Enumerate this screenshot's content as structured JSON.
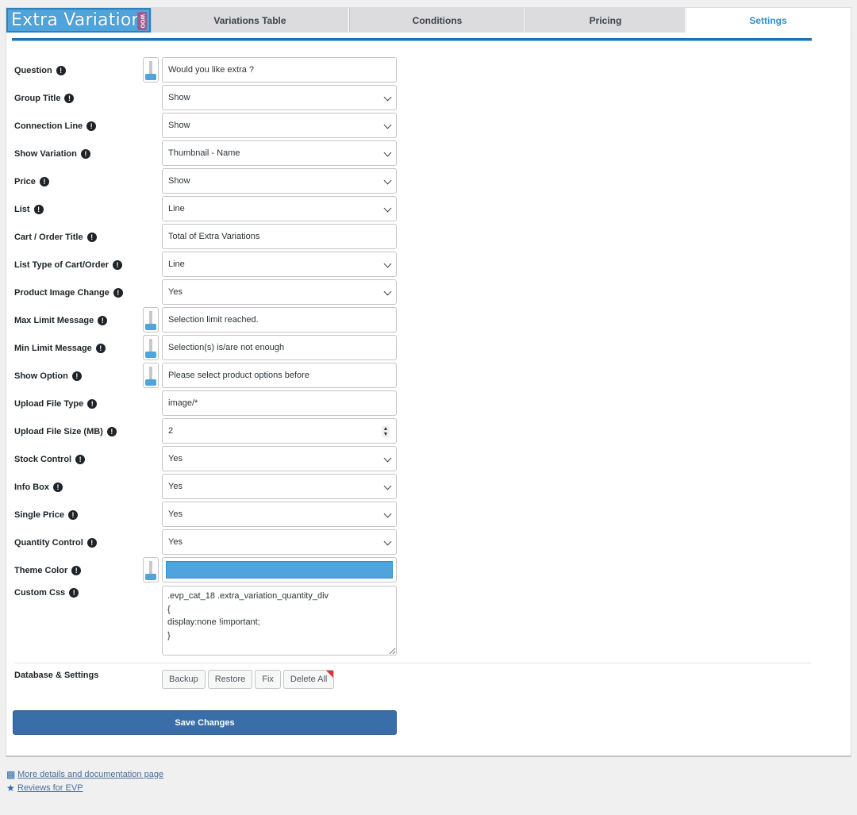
{
  "header": {
    "logo_text": "Extra Variation",
    "logo_badge": "WOO",
    "tabs": [
      {
        "label": "Variations Table",
        "active": false
      },
      {
        "label": "Conditions",
        "active": false
      },
      {
        "label": "Pricing",
        "active": false
      },
      {
        "label": "Settings",
        "active": true
      }
    ]
  },
  "settings": {
    "info_glyph": "!",
    "rows": [
      {
        "label": "Question",
        "type": "text",
        "value": "Would you like extra ?",
        "toggle": true
      },
      {
        "label": "Group Title",
        "type": "select",
        "value": "Show"
      },
      {
        "label": "Connection Line",
        "type": "select",
        "value": "Show"
      },
      {
        "label": "Show Variation",
        "type": "select",
        "value": "Thumbnail - Name"
      },
      {
        "label": "Price",
        "type": "select",
        "value": "Show"
      },
      {
        "label": "List",
        "type": "select",
        "value": "Line"
      },
      {
        "label": "Cart / Order Title",
        "type": "text",
        "value": "Total of Extra Variations"
      },
      {
        "label": "List Type of Cart/Order",
        "type": "select",
        "value": "Line"
      },
      {
        "label": "Product Image Change",
        "type": "select",
        "value": "Yes"
      },
      {
        "label": "Max Limit Message",
        "type": "text",
        "value": "Selection limit reached.",
        "toggle": true
      },
      {
        "label": "Min Limit Message",
        "type": "text",
        "value": "Selection(s) is/are not enough",
        "toggle": true
      },
      {
        "label": "Show Option",
        "type": "text",
        "value": "Please select product options before",
        "toggle": true
      },
      {
        "label": "Upload File Type",
        "type": "text",
        "value": "image/*"
      },
      {
        "label": "Upload File Size (MB)",
        "type": "number",
        "value": "2"
      },
      {
        "label": "Stock Control",
        "type": "select",
        "value": "Yes"
      },
      {
        "label": "Info Box",
        "type": "select",
        "value": "Yes"
      },
      {
        "label": "Single Price",
        "type": "select",
        "value": "Yes"
      },
      {
        "label": "Quantity Control",
        "type": "select",
        "value": "Yes"
      },
      {
        "label": "Theme Color",
        "type": "color",
        "value": "#4ea4db",
        "toggle": true
      }
    ],
    "custom_css": {
      "label": "Custom Css",
      "value": ".evp_cat_18 .extra_variation_quantity_div\n{\ndisplay:none !important;\n}"
    },
    "database": {
      "label": "Database & Settings",
      "buttons": [
        "Backup",
        "Restore",
        "Fix",
        "Delete All"
      ]
    },
    "save_label": "Save Changes"
  },
  "footer": {
    "links": [
      {
        "icon": "book-icon",
        "label": "More details and documentation page"
      },
      {
        "icon": "star-icon",
        "label": "Reviews for EVP"
      }
    ]
  },
  "colors": {
    "accent": "#2271b1",
    "logo_bg": "#4ea4db",
    "save_button": "#3a6ea8",
    "active_tab_text": "#2f8fcf",
    "danger_corner": "#d63638"
  }
}
